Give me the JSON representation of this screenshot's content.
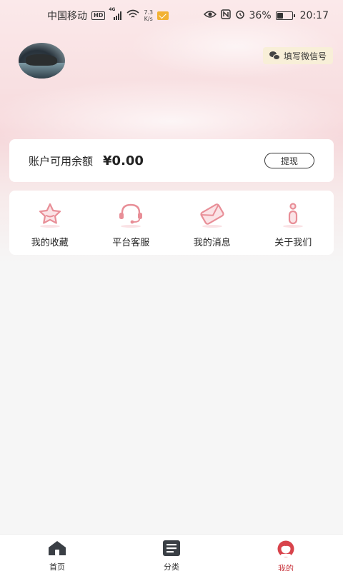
{
  "status_bar": {
    "carrier": "中国移动",
    "hd_badge": "HD",
    "network": "4G",
    "speed_value": "7.3",
    "speed_unit": "K/s",
    "battery_percent": "36%",
    "battery_level": 0.36,
    "time": "20:17"
  },
  "profile": {
    "wechat_button_label": "填写微信号"
  },
  "balance": {
    "label": "账户可用余额",
    "value": "¥0.00",
    "withdraw_label": "提现"
  },
  "menu": {
    "items": [
      {
        "label": "我的收藏",
        "icon": "star-icon"
      },
      {
        "label": "平台客服",
        "icon": "headset-icon"
      },
      {
        "label": "我的消息",
        "icon": "message-icon"
      },
      {
        "label": "关于我们",
        "icon": "info-icon"
      }
    ]
  },
  "tab_bar": {
    "items": [
      {
        "label": "首页",
        "icon": "home-icon",
        "active": false
      },
      {
        "label": "分类",
        "icon": "list-icon",
        "active": false
      },
      {
        "label": "我的",
        "icon": "profile-icon",
        "active": true
      }
    ]
  },
  "colors": {
    "accent": "#c8333b",
    "icon_pink": "#e88e97",
    "wechat_bg": "#f8efd8",
    "page_bg": "#f6f6f6"
  }
}
